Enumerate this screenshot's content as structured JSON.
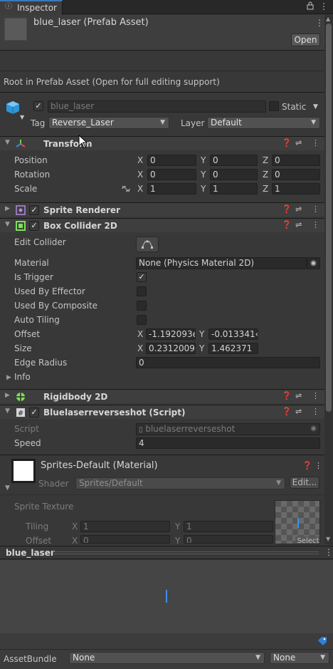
{
  "tab": {
    "title": "Inspector"
  },
  "asset": {
    "name": "blue_laser (Prefab Asset)",
    "open_label": "Open"
  },
  "prefab_note": "Root in Prefab Asset (Open for full editing support)",
  "gameobject": {
    "name": "blue_laser",
    "static_label": "Static",
    "tag_label": "Tag",
    "tag_value": "Reverse_Laser",
    "layer_label": "Layer",
    "layer_value": "Default"
  },
  "transform": {
    "title": "Transform",
    "position": {
      "label": "Position",
      "x": "0",
      "y": "0",
      "z": "0"
    },
    "rotation": {
      "label": "Rotation",
      "x": "0",
      "y": "0",
      "z": "0"
    },
    "scale": {
      "label": "Scale",
      "x": "1",
      "y": "1",
      "z": "1"
    }
  },
  "sprite_renderer": {
    "title": "Sprite Renderer"
  },
  "box_collider": {
    "title": "Box Collider 2D",
    "edit_collider": "Edit Collider",
    "material_label": "Material",
    "material_value": "None (Physics Material 2D)",
    "is_trigger": "Is Trigger",
    "used_by_effector": "Used By Effector",
    "used_by_composite": "Used By Composite",
    "auto_tiling": "Auto Tiling",
    "offset_label": "Offset",
    "offset_x": "-1.192093e",
    "offset_y": "-0.013341‹",
    "size_label": "Size",
    "size_x": "0.2312009",
    "size_y": "1.462371",
    "edge_radius_label": "Edge Radius",
    "edge_radius_value": "0",
    "info_label": "Info"
  },
  "rigidbody": {
    "title": "Rigidbody 2D"
  },
  "script_comp": {
    "title": "Bluelaserreverseshot (Script)",
    "script_label": "Script",
    "script_value": "bluelaserreverseshot",
    "speed_label": "Speed",
    "speed_value": "4"
  },
  "material": {
    "title": "Sprites-Default (Material)",
    "shader_label": "Shader",
    "shader_value": "Sprites/Default",
    "edit_label": "Edit...",
    "sprite_texture": "Sprite Texture",
    "tiling_label": "Tiling",
    "tiling_x": "1",
    "tiling_y": "1",
    "offset_label": "Offset",
    "offset_x": "0",
    "offset_y": "0",
    "select_label": "Select"
  },
  "preview": {
    "title": "blue_laser"
  },
  "assetbundle": {
    "label": "AssetBundle",
    "bundle_value": "None",
    "variant_value": "None"
  },
  "axes": {
    "x": "X",
    "y": "Y",
    "z": "Z"
  },
  "colors": {
    "background": "#383838",
    "header": "#3e3e3e",
    "field": "#2a2a2a",
    "laser": "#3d8ee8"
  },
  "icons": [
    "lock-icon",
    "kebab-menu-icon",
    "cube-icon",
    "transform-axes-icon",
    "help-icon",
    "preset-icon",
    "sprite-renderer-icon",
    "box-collider-icon",
    "rigidbody-icon",
    "script-icon",
    "asset-label-icon"
  ]
}
